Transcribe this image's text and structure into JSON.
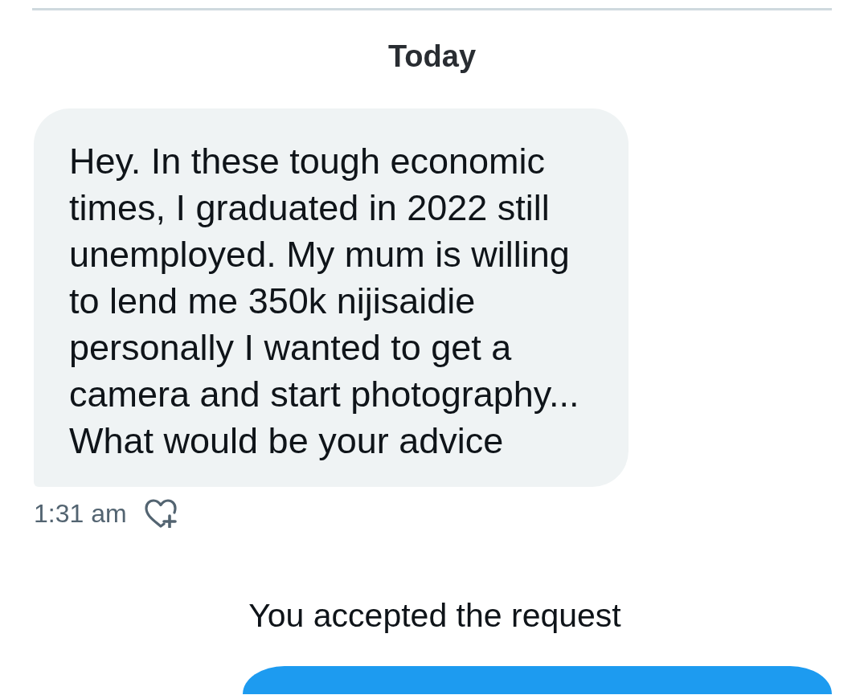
{
  "thread": [
    {
      "kind": "date",
      "text": "Today"
    },
    {
      "kind": "received",
      "text": "Hey. In these tough economic times, I graduated in 2022 still unemployed. My mum is willing to lend me 350k nijisaidie personally I wanted to get a camera and start photography... What would be your advice",
      "time": "1:31 am"
    },
    {
      "kind": "notice",
      "text": "You accepted the request"
    },
    {
      "kind": "sent"
    }
  ]
}
